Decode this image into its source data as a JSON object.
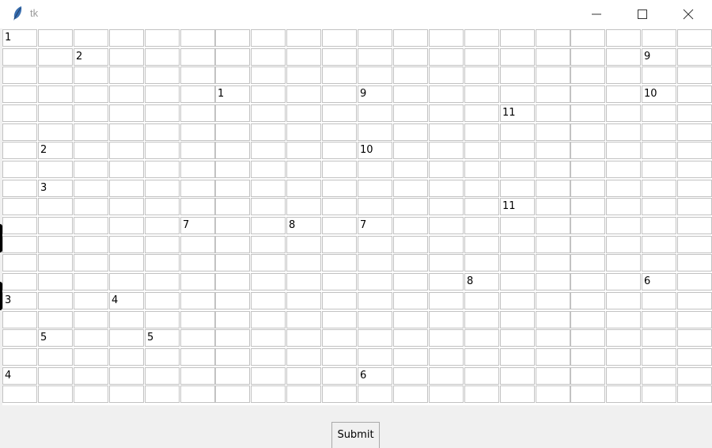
{
  "window": {
    "title": "tk",
    "app_icon": "feather-icon",
    "controls": [
      "minimize-icon",
      "maximize-icon",
      "close-icon"
    ]
  },
  "grid": {
    "rows": 20,
    "cols": 20,
    "entries": [
      {
        "row": 0,
        "col": 0,
        "value": "1"
      },
      {
        "row": 1,
        "col": 2,
        "value": "2"
      },
      {
        "row": 1,
        "col": 18,
        "value": "9"
      },
      {
        "row": 3,
        "col": 6,
        "value": "1"
      },
      {
        "row": 3,
        "col": 10,
        "value": "9"
      },
      {
        "row": 3,
        "col": 18,
        "value": "10"
      },
      {
        "row": 4,
        "col": 14,
        "value": "11"
      },
      {
        "row": 6,
        "col": 1,
        "value": "2"
      },
      {
        "row": 6,
        "col": 10,
        "value": "10"
      },
      {
        "row": 8,
        "col": 1,
        "value": "3"
      },
      {
        "row": 9,
        "col": 14,
        "value": "11"
      },
      {
        "row": 10,
        "col": 5,
        "value": "7"
      },
      {
        "row": 10,
        "col": 8,
        "value": "8"
      },
      {
        "row": 10,
        "col": 10,
        "value": "7"
      },
      {
        "row": 13,
        "col": 13,
        "value": "8"
      },
      {
        "row": 13,
        "col": 18,
        "value": "6"
      },
      {
        "row": 14,
        "col": 0,
        "value": "3"
      },
      {
        "row": 14,
        "col": 3,
        "value": "4"
      },
      {
        "row": 16,
        "col": 1,
        "value": "5"
      },
      {
        "row": 16,
        "col": 4,
        "value": "5"
      },
      {
        "row": 18,
        "col": 0,
        "value": "4"
      },
      {
        "row": 18,
        "col": 10,
        "value": "6"
      }
    ]
  },
  "submit_button": {
    "label": "Submit"
  }
}
